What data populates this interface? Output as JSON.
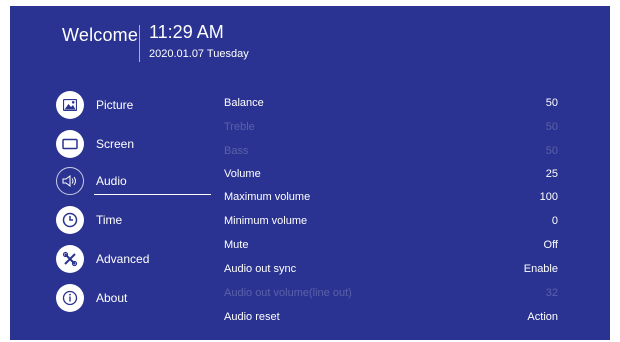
{
  "header": {
    "welcome": "Welcome",
    "time": "11:29 AM",
    "date": "2020.01.07 Tuesday"
  },
  "sidebar": {
    "items": [
      {
        "label": "Picture",
        "icon": "picture-icon"
      },
      {
        "label": "Screen",
        "icon": "screen-icon"
      },
      {
        "label": "Audio",
        "icon": "speaker-icon",
        "selected": true
      },
      {
        "label": "Time",
        "icon": "clock-icon"
      },
      {
        "label": "Advanced",
        "icon": "tools-icon"
      },
      {
        "label": "About",
        "icon": "info-icon"
      }
    ]
  },
  "settings": [
    {
      "name": "Balance",
      "value": "50",
      "enabled": true
    },
    {
      "name": "Treble",
      "value": "50",
      "enabled": false
    },
    {
      "name": "Bass",
      "value": "50",
      "enabled": false
    },
    {
      "name": "Volume",
      "value": "25",
      "enabled": true
    },
    {
      "name": "Maximum volume",
      "value": "100",
      "enabled": true
    },
    {
      "name": "Minimum volume",
      "value": "0",
      "enabled": true
    },
    {
      "name": "Mute",
      "value": "Off",
      "enabled": true
    },
    {
      "name": "Audio out sync",
      "value": "Enable",
      "enabled": true
    },
    {
      "name": "Audio out volume(line out)",
      "value": "32",
      "enabled": false
    },
    {
      "name": "Audio reset",
      "value": "Action",
      "enabled": true
    }
  ],
  "colors": {
    "background": "#2a3391",
    "text": "#ffffff",
    "icon_color": "#2a3391"
  }
}
